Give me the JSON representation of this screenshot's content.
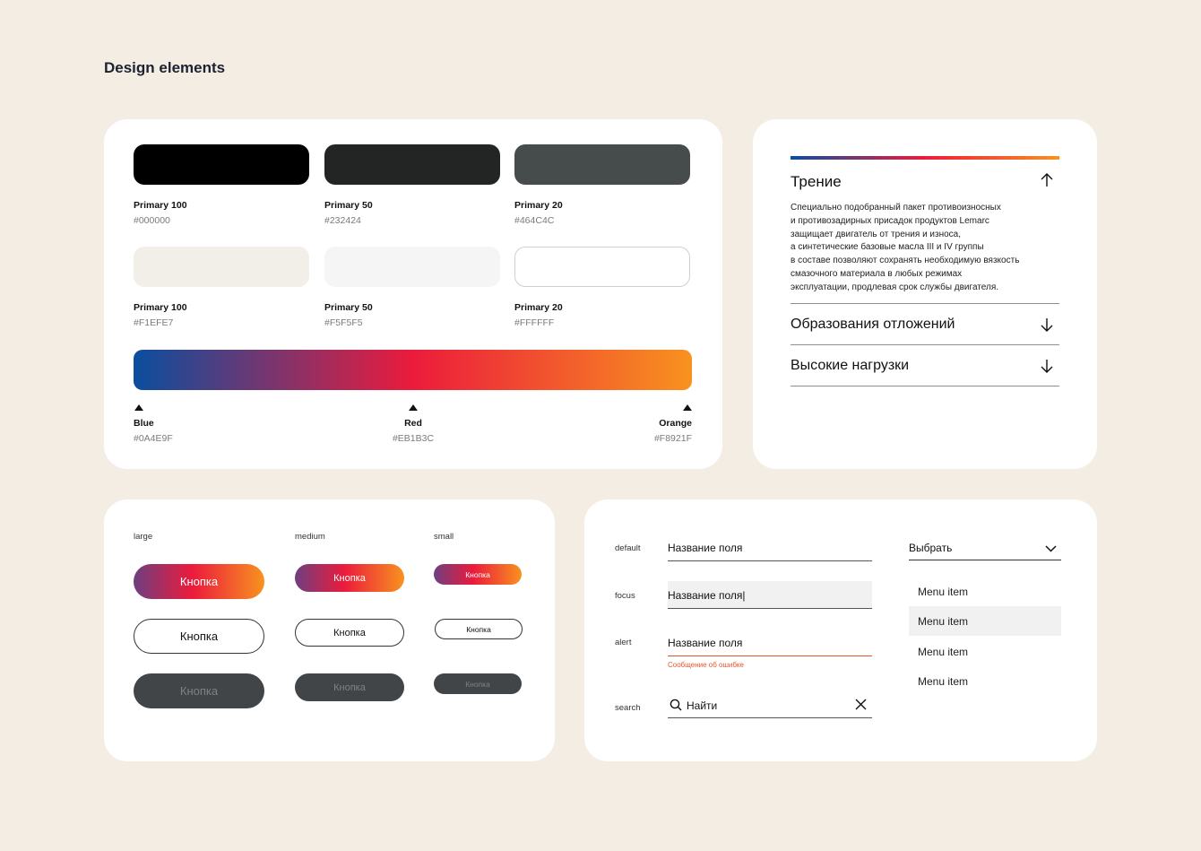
{
  "page_title": "Design elements",
  "colors": {
    "swatches": [
      {
        "label": "Primary 100",
        "hex": "#000000",
        "color": "#000000"
      },
      {
        "label": "Primary 50",
        "hex": "#232424",
        "color": "#232424"
      },
      {
        "label": "Primary 20",
        "hex": "#464C4C",
        "color": "#464C4C"
      },
      {
        "label": "Primary 100",
        "hex": "#F1EFE7",
        "color": "#F1EFE7"
      },
      {
        "label": "Primary 50",
        "hex": "#F5F5F5",
        "color": "#F5F5F5"
      },
      {
        "label": "Primary 20",
        "hex": "#FFFFFF",
        "color": "#FFFFFF"
      }
    ],
    "gradient_stops": [
      {
        "name": "Blue",
        "hex": "#0A4E9F"
      },
      {
        "name": "Red",
        "hex": "#EB1B3C"
      },
      {
        "name": "Orange",
        "hex": "#F8921F"
      }
    ]
  },
  "accordion": {
    "open_title": "Трение",
    "open_text": [
      "Специально подобранный пакет противоизносных",
      "и противозадирных присадок продуктов Lemarc",
      "защищает двигатель от трения и износа,",
      "а синтетические базовые масла III и IV группы",
      "в составе позволяют сохранять необходимую вязкость",
      "смазочного материала в любых режимах",
      "эксплуатации, продлевая срок службы двигателя."
    ],
    "items": [
      "Образования отложений",
      "Высокие нагрузки"
    ]
  },
  "buttons": {
    "sizes": [
      "large",
      "medium",
      "small"
    ],
    "label": "Кнопка"
  },
  "inputs": {
    "states": {
      "default": "default",
      "focus": "focus",
      "alert": "alert",
      "search": "search"
    },
    "field_value": "Название поля",
    "focus_value": "Название поля|",
    "error_message": "Сообщение об ошибке",
    "search_value": "Найти",
    "select_value": "Выбрать",
    "menu_items": [
      "Menu item",
      "Menu item",
      "Menu item",
      "Menu item"
    ]
  },
  "theme": {
    "background": "#F4EDE3",
    "gradient": [
      "#0A4E9F",
      "#EB1B3C",
      "#F8921F"
    ],
    "error": "#E8542A"
  }
}
